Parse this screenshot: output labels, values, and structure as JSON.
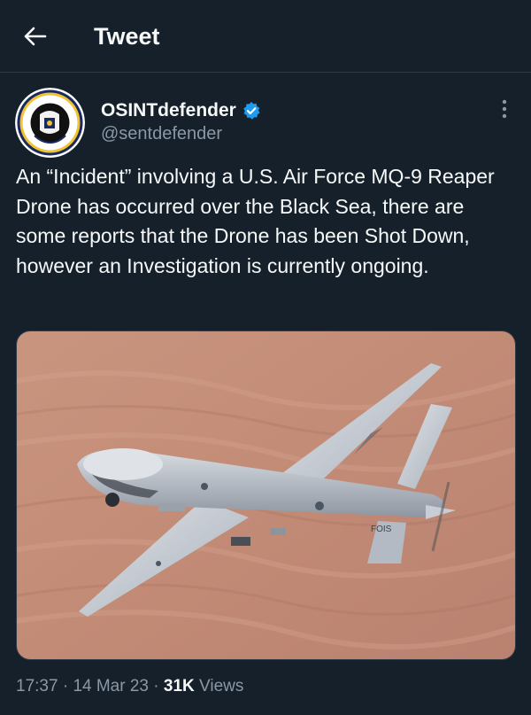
{
  "header": {
    "title": "Tweet",
    "back_icon": "arrow-left-icon"
  },
  "author": {
    "display_name": "OSINTdefender",
    "handle": "@sentdefender",
    "verified": true,
    "verified_color": "#1d9bf0",
    "avatar_icon": "osint-defender-seal-logo",
    "avatar_text": "OSINT DEFENDER · INTELLIGENCE · DOMINATE"
  },
  "tweet": {
    "text": "An “Incident” involving a U.S. Air Force MQ-9 Reaper Drone has occurred over the Black Sea, there are some reports that the Drone has been Shot Down, however an Investigation is currently ongoing.",
    "media_description_icon": "mq9-reaper-drone-photo",
    "tail_marking": "FOIS"
  },
  "meta": {
    "time": "17:37",
    "sep1": " · ",
    "date": "14 Mar 23",
    "sep2": " · ",
    "views_count": "31K",
    "views_label": " Views"
  },
  "colors": {
    "background": "#15202b",
    "text": "#f7f9f9",
    "secondary_text": "#8b98a5",
    "divider": "#2f3b47"
  }
}
